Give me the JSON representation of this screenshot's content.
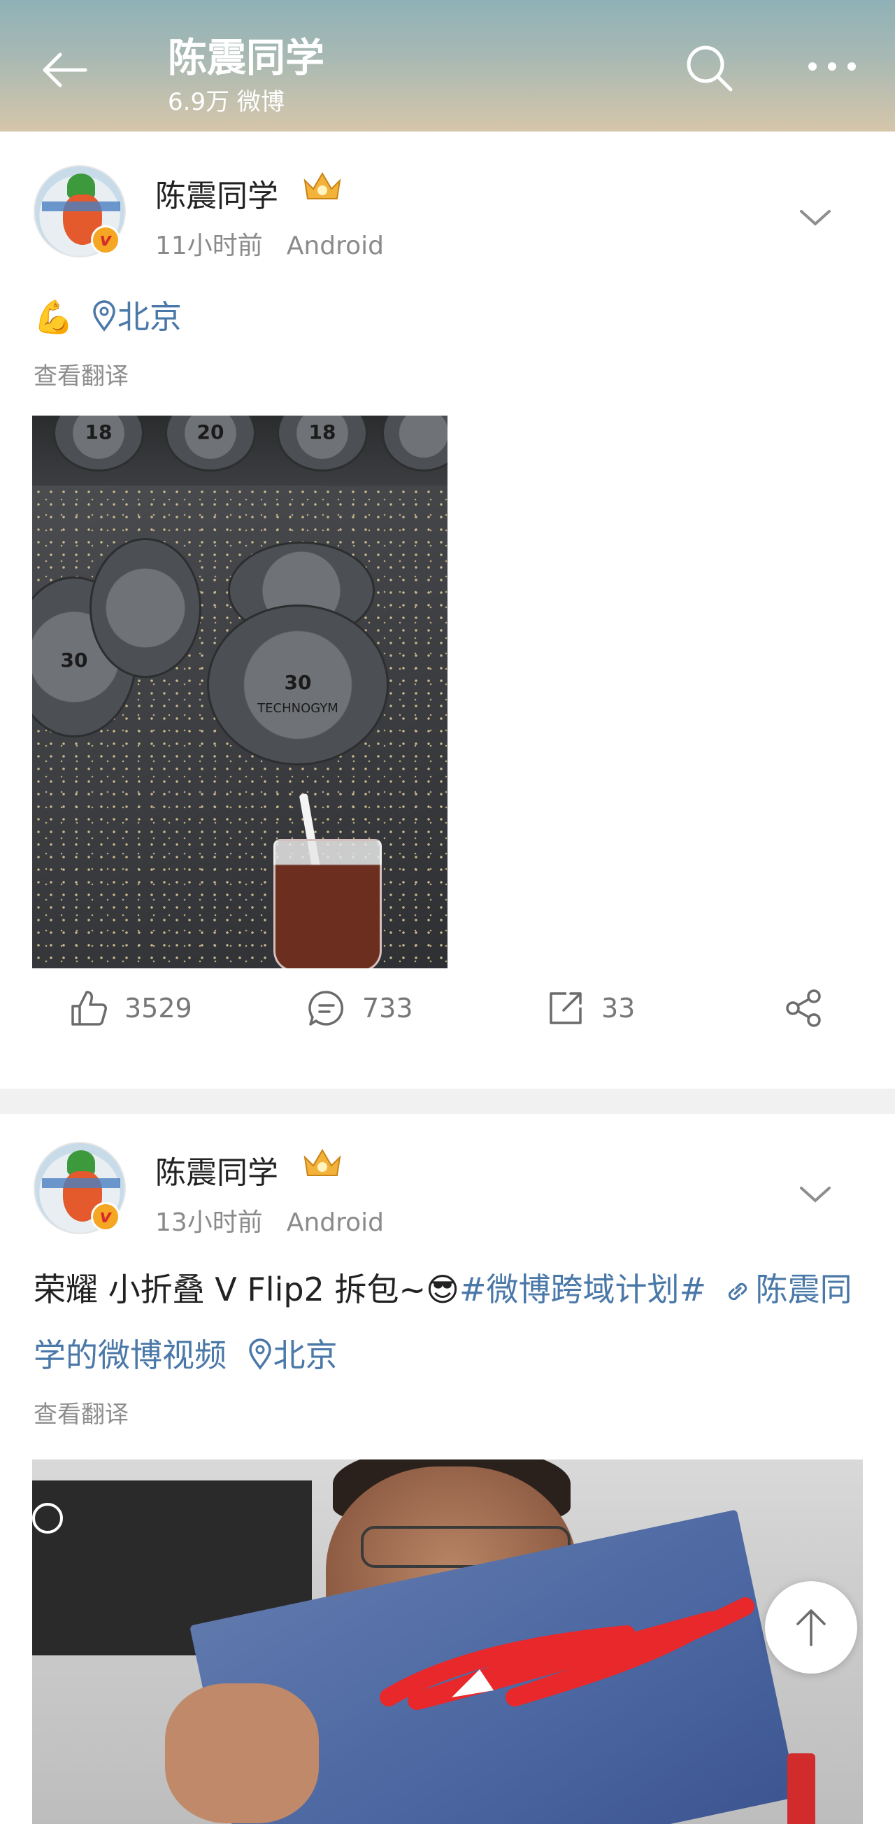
{
  "header": {
    "title": "陈震同学",
    "subtitle": "6.9万 微博",
    "icons": [
      "back-arrow-icon",
      "search-icon",
      "more-icon"
    ]
  },
  "posts": [
    {
      "username": "陈震同学",
      "time": "11小时前",
      "source": "Android",
      "emoji": "💪",
      "location": "北京",
      "translate": "查看翻译",
      "likes": "3529",
      "comments": "733",
      "reposts": "33"
    },
    {
      "username": "陈震同学",
      "time": "13小时前",
      "source": "Android",
      "text": "荣耀 小折叠 V Flip2 拆包~",
      "emoji": "😎",
      "topic": "#微博跨域计划#",
      "link_text": "陈震同学的微博视频",
      "location": "北京",
      "translate": "查看翻译"
    }
  ],
  "photo_labels": {
    "rack_numbers": [
      "18",
      "20",
      "18"
    ],
    "plate_number": "30",
    "brand": "TECHNOGYM"
  },
  "colors": {
    "link": "#4a78a8",
    "meta": "#8a8a8a",
    "header_gradient_top": "#8fb1b7",
    "header_gradient_bottom": "#d6c6aa"
  }
}
